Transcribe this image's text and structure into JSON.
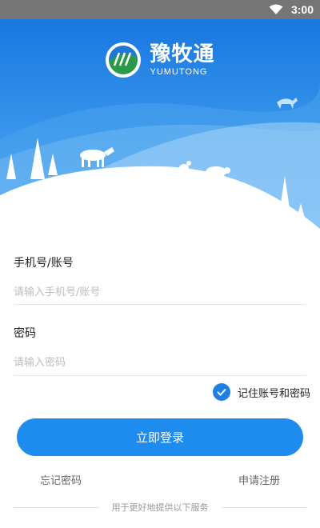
{
  "status_bar": {
    "time": "3:00",
    "icons": [
      "wifi-icon"
    ]
  },
  "app": {
    "name": "豫牧通",
    "name_en": "YUMUTONG"
  },
  "form": {
    "account": {
      "label": "手机号/账号",
      "placeholder": "请输入手机号/账号",
      "value": ""
    },
    "password": {
      "label": "密码",
      "placeholder": "请输入密码",
      "value": ""
    },
    "remember": {
      "label": "记住账号和密码",
      "checked": true
    }
  },
  "actions": {
    "login_label": "立即登录",
    "forgot_label": "忘记密码",
    "register_label": "申请注册"
  },
  "footer": {
    "service_text": "用于更好地提供以下服务"
  },
  "colors": {
    "primary": "#1e8bee",
    "status_bar": "#757575",
    "sky_top": "#1a7fe3",
    "sky_light": "#8ec8f5"
  }
}
